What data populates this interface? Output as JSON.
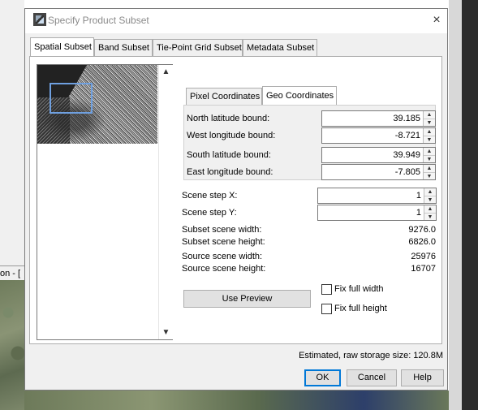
{
  "dialog": {
    "title": "Specify Product Subset",
    "close_icon": "×"
  },
  "background": {
    "label": "on - ["
  },
  "tabs": [
    {
      "label": "Spatial Subset"
    },
    {
      "label": "Band Subset"
    },
    {
      "label": "Tie-Point Grid Subset"
    },
    {
      "label": "Metadata Subset"
    }
  ],
  "coord_tabs": [
    {
      "label": "Pixel Coordinates"
    },
    {
      "label": "Geo Coordinates"
    }
  ],
  "geo": {
    "north_label": "North latitude bound:",
    "north_value": "39.185",
    "west_label": "West longitude bound:",
    "west_value": "-8.721",
    "south_label": "South latitude bound:",
    "south_value": "39.949",
    "east_label": "East longitude bound:",
    "east_value": "-7.805"
  },
  "scene": {
    "step_x_label": "Scene step X:",
    "step_x_value": "1",
    "step_y_label": "Scene step Y:",
    "step_y_value": "1",
    "subset_width_label": "Subset scene width:",
    "subset_width_value": "9276.0",
    "subset_height_label": "Subset scene height:",
    "subset_height_value": "6826.0",
    "source_width_label": "Source scene width:",
    "source_width_value": "25976",
    "source_height_label": "Source scene height:",
    "source_height_value": "16707"
  },
  "preview": {
    "use_preview_label": "Use Preview",
    "fix_width_label": "Fix full width",
    "fix_height_label": "Fix full height"
  },
  "footer": {
    "estimate_text": "Estimated, raw storage size: 120.8M",
    "ok_label": "OK",
    "cancel_label": "Cancel",
    "help_label": "Help"
  },
  "icons": {
    "scroll_up": "▲",
    "scroll_down": "▼",
    "spin_up": "▲",
    "spin_down": "▼"
  }
}
